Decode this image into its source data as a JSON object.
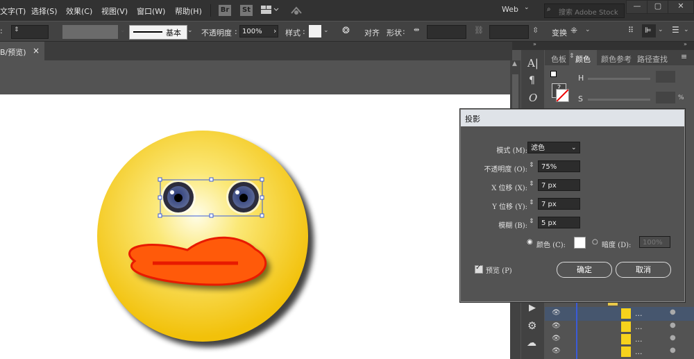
{
  "menu": {
    "items": [
      "文字(T)",
      "选择(S)",
      "效果(C)",
      "视图(V)",
      "窗口(W)",
      "帮助(H)"
    ],
    "app_icons": [
      "Br",
      "St"
    ],
    "workspace": "Web",
    "search_placeholder": "搜索 Adobe Stock"
  },
  "control": {
    "stroke_profile": "基本",
    "opacity_label": "不透明度",
    "opacity_value": "100%",
    "style_label": "样式",
    "align_label": "对齐",
    "shape_label": "形状",
    "transform_label": "变换"
  },
  "document": {
    "tab_title": "B/预览)",
    "close_glyph": "×"
  },
  "panels": {
    "tabs": [
      "色板",
      "颜色",
      "颜色参考",
      "路径查找"
    ],
    "h_label": "H",
    "s_label": "S",
    "percent": "%",
    "layer_rows": [
      "...",
      "...",
      "...",
      "..."
    ]
  },
  "dialog": {
    "title": "投影",
    "mode_label": "模式 (M):",
    "mode_value": "滤色",
    "opacity_label": "不透明度 (O):",
    "opacity_value": "75%",
    "x_label": "X 位移 (X):",
    "x_value": "7 px",
    "y_label": "Y 位移 (Y):",
    "y_value": "7 px",
    "blur_label": "模糊 (B):",
    "blur_value": "5 px",
    "color_label": "颜色 (C):",
    "darkness_label": "暗度 (D):",
    "darkness_value": "100%",
    "preview_label": "预览 (P)",
    "ok_label": "确定",
    "cancel_label": "取消",
    "shadow_color": "#ffffff"
  },
  "colors": {
    "face_yellow": "#f6d21c",
    "beak_orange": "#ff5a0a",
    "beak_stroke": "#e81a00",
    "selection_blue": "#3a5bd9"
  }
}
